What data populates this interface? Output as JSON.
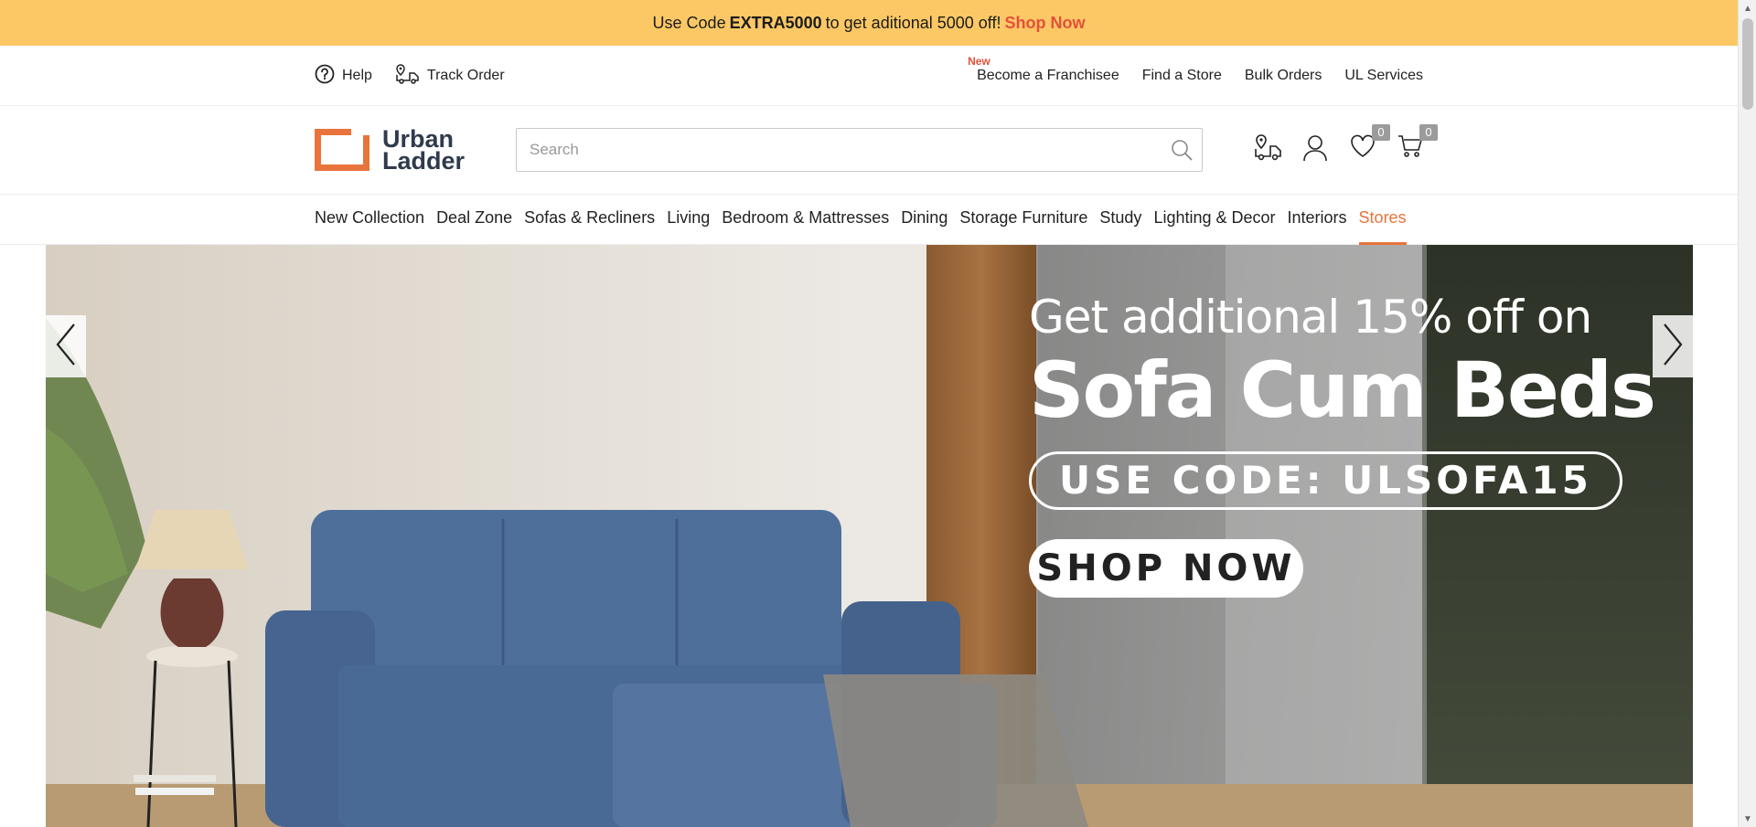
{
  "promo": {
    "prefix": "Use Code",
    "code": "EXTRA5000",
    "suffix": "to get aditional 5000 off!",
    "link": "Shop Now"
  },
  "utility": {
    "help": "Help",
    "track_order": "Track Order",
    "new_tag": "New",
    "links": [
      "Become a Franchisee",
      "Find a Store",
      "Bulk Orders",
      "UL Services"
    ]
  },
  "header": {
    "logo_line1": "Urban",
    "logo_line2": "Ladder",
    "search_placeholder": "Search",
    "wishlist_count": "0",
    "cart_count": "0"
  },
  "nav": {
    "items": [
      "New Collection",
      "Deal Zone",
      "Sofas & Recliners",
      "Living",
      "Bedroom & Mattresses",
      "Dining",
      "Storage Furniture",
      "Study",
      "Lighting & Decor",
      "Interiors",
      "Stores"
    ],
    "active": "Stores"
  },
  "hero": {
    "line1": "Get additional 15% off on",
    "line2": "Sofa Cum Beds",
    "code": "USE CODE: ULSOFA15",
    "cta": "SHOP NOW"
  },
  "colors": {
    "promo_bg": "#fcc865",
    "accent": "#e8743c",
    "promo_link": "#e4503c",
    "logo_text": "#2f3b4c",
    "sofa": "#4a6d9a"
  },
  "icons": [
    "help-icon",
    "track-order-icon",
    "search-icon",
    "store-locator-icon",
    "account-icon",
    "wishlist-icon",
    "cart-icon",
    "chevron-left-icon",
    "chevron-right-icon"
  ]
}
